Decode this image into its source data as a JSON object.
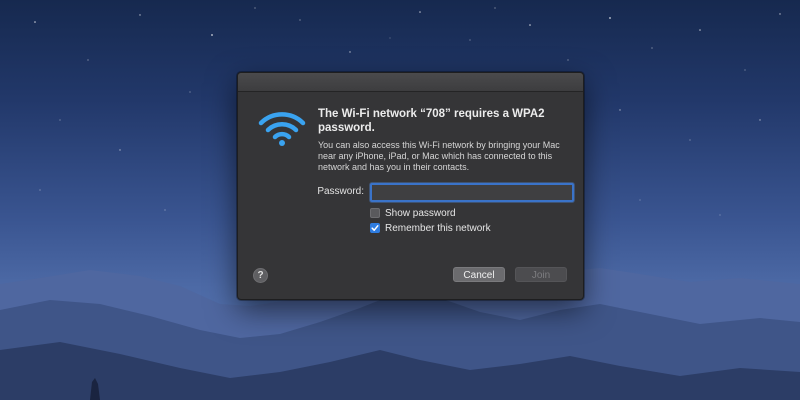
{
  "dialog": {
    "heading": "The Wi-Fi network “708” requires a WPA2 password.",
    "body": "You can also access this Wi-Fi network by bringing your Mac near any iPhone, iPad, or Mac which has connected to this network and has you in their contacts.",
    "password_label": "Password:",
    "password_value": "",
    "show_password": {
      "label": "Show password",
      "checked": false
    },
    "remember_network": {
      "label": "Remember this network",
      "checked": true
    },
    "help_label": "?",
    "cancel_label": "Cancel",
    "join_label": "Join",
    "icon": "wifi-icon"
  },
  "colors": {
    "accent": "#2f7de1",
    "wifi_icon": "#3aa3f0",
    "dialog_bg": "#353537"
  }
}
